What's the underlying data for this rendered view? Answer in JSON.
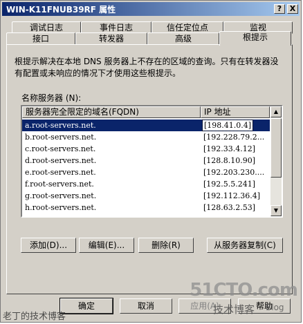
{
  "window": {
    "title": "WIN-K11FNUB39RF 属性",
    "help_button": "?",
    "close_button": "X"
  },
  "tabs_row1": [
    "调试日志",
    "事件日志",
    "信任定位点",
    "监视"
  ],
  "tabs_row2": [
    "接口",
    "转发器",
    "高级",
    "根提示"
  ],
  "description": "根提示解决在本地 DNS 服务器上不存在的区域的查询。只有在转发器没有配置或未响应的情况下才使用这些根提示。",
  "list": {
    "label": "名称服务器 (N):",
    "col_fqdn": "服务器完全限定的域名(FQDN)",
    "col_ip": "IP 地址",
    "rows": [
      {
        "name": "a.root-servers.net.",
        "ip": "[198.41.0.4]"
      },
      {
        "name": "b.root-servers.net.",
        "ip": "[192.228.79.2..."
      },
      {
        "name": "c.root-servers.net.",
        "ip": "[192.33.4.12]"
      },
      {
        "name": "d.root-servers.net.",
        "ip": "[128.8.10.90]"
      },
      {
        "name": "e.root-servers.net.",
        "ip": "[192.203.230...."
      },
      {
        "name": "f.root-servers.net.",
        "ip": "[192.5.5.241]"
      },
      {
        "name": "g.root-servers.net.",
        "ip": "[192.112.36.4]"
      },
      {
        "name": "h.root-servers.net.",
        "ip": "[128.63.2.53]"
      }
    ]
  },
  "buttons": {
    "add": "添加(D)...",
    "edit": "编辑(E)...",
    "remove": "删除(R)",
    "copy": "从服务器复制(C)",
    "ok": "确定",
    "cancel": "取消",
    "apply": "应用(A)",
    "help": "帮助"
  },
  "watermark": {
    "logo": "51CTO.com",
    "sub": "技术博客",
    "blog": "Blog",
    "left": "老丁的技术博客"
  }
}
